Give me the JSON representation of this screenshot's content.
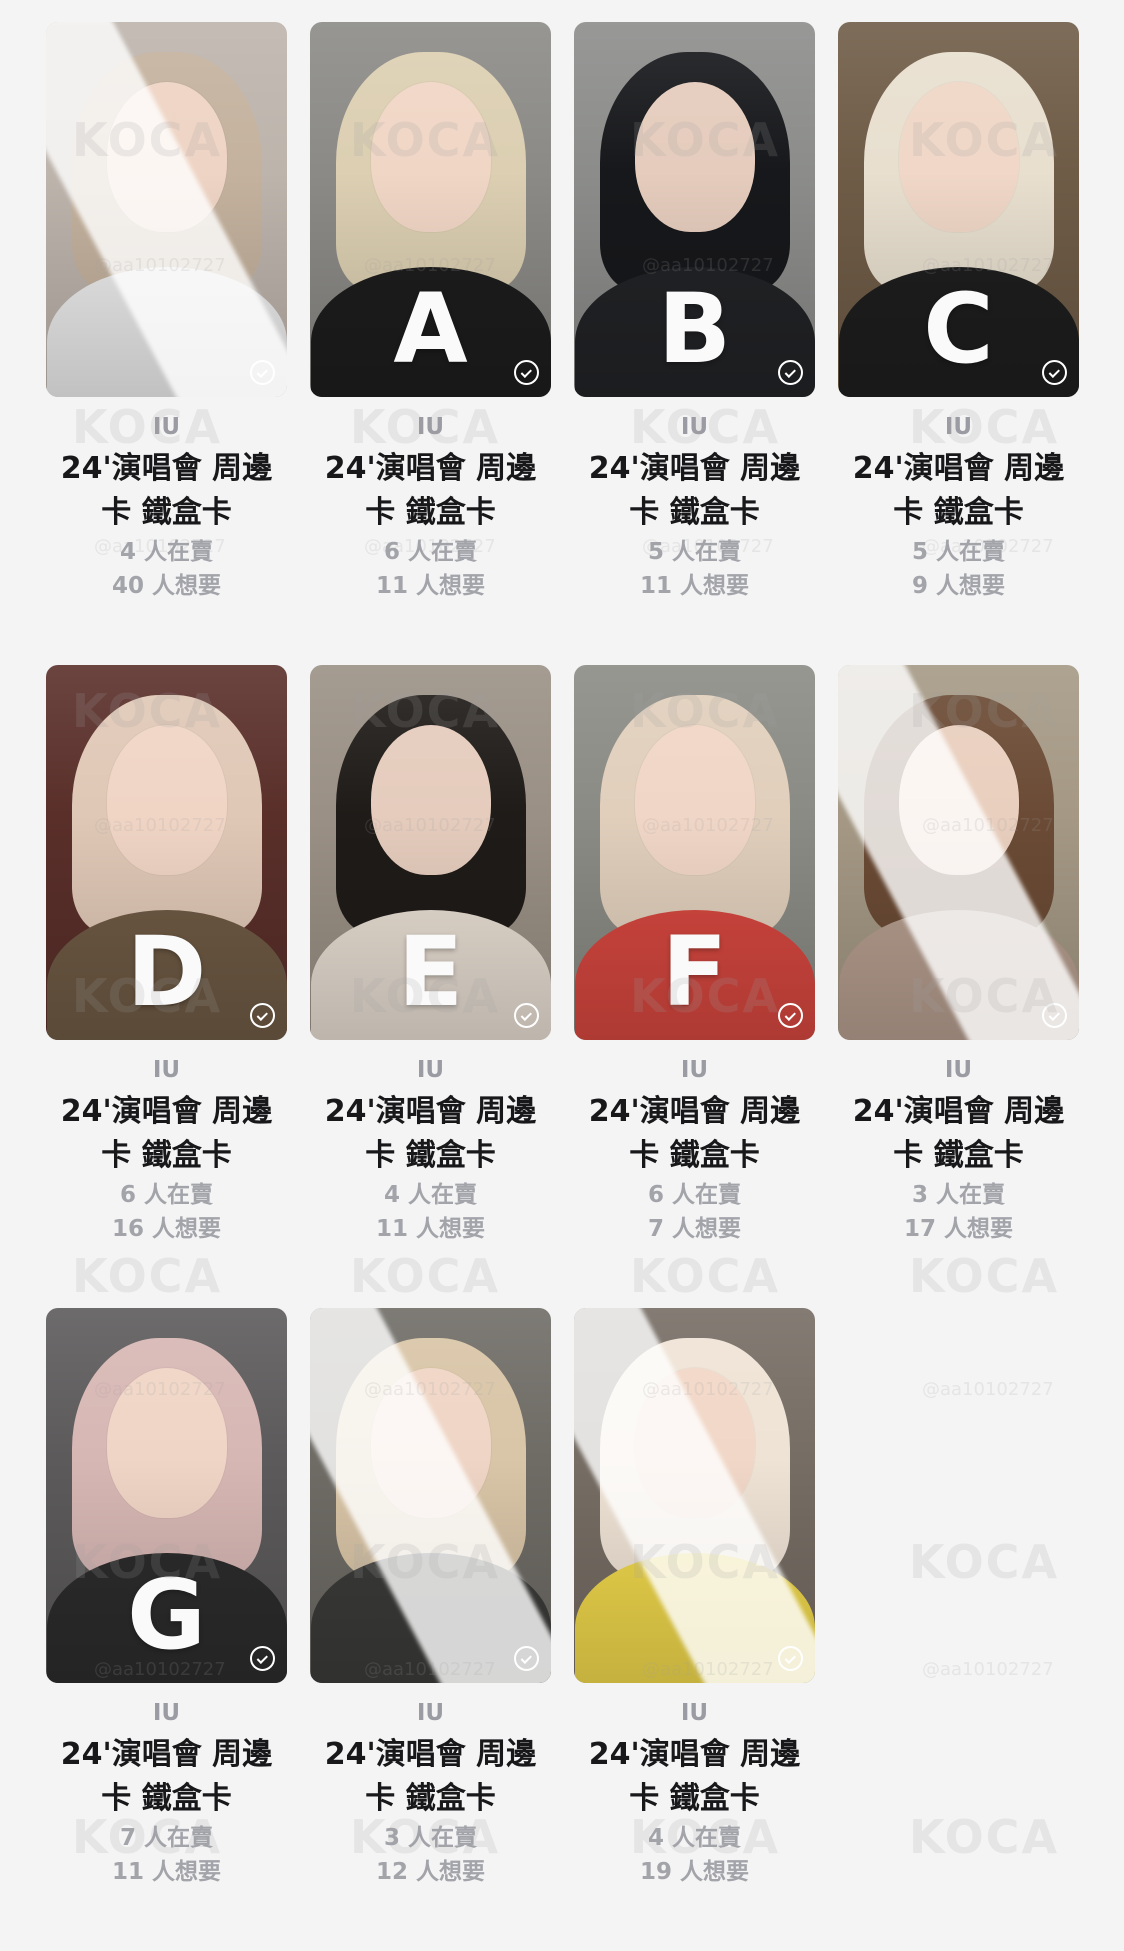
{
  "cards": [
    {
      "artist": "IU",
      "title": "24'演唱會 周邊卡 鐵盒卡",
      "sellers": "4 人在賣",
      "wants": "40 人想要",
      "letter": "",
      "glare": true,
      "colors": {
        "bg": "#bdb4ac",
        "hair": "#c4b29e",
        "body": "#ececec"
      }
    },
    {
      "artist": "IU",
      "title": "24'演唱會 周邊卡 鐵盒卡",
      "sellers": "6 人在賣",
      "wants": "11 人想要",
      "letter": "A",
      "glare": false,
      "colors": {
        "bg": "#8b8a86",
        "hair": "#dccfb2",
        "body": "#1d1d1d"
      }
    },
    {
      "artist": "IU",
      "title": "24'演唱會 周邊卡 鐵盒卡",
      "sellers": "5 人在賣",
      "wants": "11 人想要",
      "letter": "B",
      "glare": false,
      "colors": {
        "bg": "#8c8d8b",
        "hair": "#17181b",
        "body": "#222326"
      }
    },
    {
      "artist": "IU",
      "title": "24'演唱會 周邊卡 鐵盒卡",
      "sellers": "5 人在賣",
      "wants": "9 人想要",
      "letter": "C",
      "glare": false,
      "colors": {
        "bg": "#6f5c47",
        "hair": "#e8dfcf",
        "body": "#1e1e1e"
      }
    },
    {
      "artist": "IU",
      "title": "24'演唱會 周邊卡 鐵盒卡",
      "sellers": "6 人在賣",
      "wants": "16 人想要",
      "letter": "D",
      "glare": false,
      "colors": {
        "bg": "#5a2f2a",
        "hair": "#e0c8b6",
        "body": "#6e5a44"
      }
    },
    {
      "artist": "IU",
      "title": "24'演唱會 周邊卡 鐵盒卡",
      "sellers": "4 人在賣",
      "wants": "11 人想要",
      "letter": "E",
      "glare": false,
      "colors": {
        "bg": "#9a9085",
        "hair": "#1f1b18",
        "body": "#e7ddd2"
      }
    },
    {
      "artist": "IU",
      "title": "24'演唱會 周邊卡 鐵盒卡",
      "sellers": "6 人在賣",
      "wants": "7 人想要",
      "letter": "F",
      "glare": false,
      "colors": {
        "bg": "#8b8b85",
        "hair": "#e1cfbc",
        "body": "#d4473f"
      }
    },
    {
      "artist": "IU",
      "title": "24'演唱會 周邊卡 鐵盒卡",
      "sellers": "3 人在賣",
      "wants": "17 人想要",
      "letter": "",
      "glare": true,
      "colors": {
        "bg": "#a59985",
        "hair": "#6b4b35",
        "body": "#b59d8e"
      }
    },
    {
      "artist": "IU",
      "title": "24'演唱會 周邊卡 鐵盒卡",
      "sellers": "7 人在賣",
      "wants": "11 人想要",
      "letter": "G",
      "glare": false,
      "colors": {
        "bg": "#5c5a5b",
        "hair": "#d7b7b4",
        "body": "#2c2c2c"
      }
    },
    {
      "artist": "IU",
      "title": "24'演唱會 周邊卡 鐵盒卡",
      "sellers": "3 人在賣",
      "wants": "12 人想要",
      "letter": "",
      "glare": true,
      "colors": {
        "bg": "#6f6c66",
        "hair": "#d9c5a7",
        "body": "#3b3b39"
      }
    },
    {
      "artist": "IU",
      "title": "24'演唱會 周邊卡 鐵盒卡",
      "sellers": "4 人在賣",
      "wants": "19 人想要",
      "letter": "",
      "glare": true,
      "colors": {
        "bg": "#766d64",
        "hair": "#efe3d5",
        "body": "#f0d84c"
      }
    }
  ],
  "watermarks": {
    "brand": "KOCA",
    "user": "@aa10102727"
  }
}
